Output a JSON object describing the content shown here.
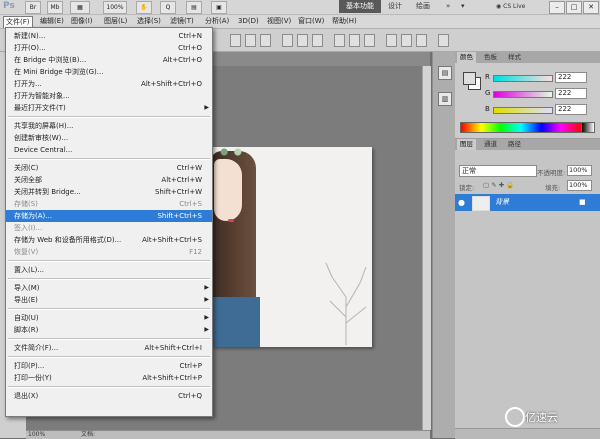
{
  "app": {
    "logo": "Ps",
    "zoom_value": "100%",
    "workspace_active": "基本功能",
    "workspace_items": [
      "设计",
      "绘画"
    ],
    "cs_live": "CS Live"
  },
  "menubar": [
    "文件(F)",
    "编辑(E)",
    "图像(I)",
    "图层(L)",
    "选择(S)",
    "滤镜(T)",
    "分析(A)",
    "3D(D)",
    "视图(V)",
    "窗口(W)",
    "帮助(H)"
  ],
  "file_menu": [
    {
      "label": "新建(N)...",
      "shortcut": "Ctrl+N"
    },
    {
      "label": "打开(O)...",
      "shortcut": "Ctrl+O"
    },
    {
      "label": "在 Bridge 中浏览(B)...",
      "shortcut": "Alt+Ctrl+O"
    },
    {
      "label": "在 Mini Bridge 中浏览(G)...",
      "shortcut": ""
    },
    {
      "label": "打开为...",
      "shortcut": "Alt+Shift+Ctrl+O"
    },
    {
      "label": "打开为智能对象...",
      "shortcut": ""
    },
    {
      "label": "最近打开文件(T)",
      "shortcut": "",
      "submenu": true
    },
    {
      "sep": true
    },
    {
      "label": "共享我的屏幕(H)...",
      "shortcut": ""
    },
    {
      "label": "创建新审核(W)...",
      "shortcut": ""
    },
    {
      "label": "Device Central...",
      "shortcut": ""
    },
    {
      "sep": true
    },
    {
      "label": "关闭(C)",
      "shortcut": "Ctrl+W"
    },
    {
      "label": "关闭全部",
      "shortcut": "Alt+Ctrl+W"
    },
    {
      "label": "关闭并转到 Bridge...",
      "shortcut": "Shift+Ctrl+W"
    },
    {
      "label": "存储(S)",
      "shortcut": "Ctrl+S",
      "disabled": true
    },
    {
      "label": "存储为(A)...",
      "shortcut": "Shift+Ctrl+S",
      "highlight": true
    },
    {
      "label": "签入(I)...",
      "shortcut": "",
      "disabled": true
    },
    {
      "label": "存储为 Web 和设备所用格式(D)...",
      "shortcut": "Alt+Shift+Ctrl+S"
    },
    {
      "label": "恢复(V)",
      "shortcut": "F12",
      "disabled": true
    },
    {
      "sep": true
    },
    {
      "label": "置入(L)...",
      "shortcut": ""
    },
    {
      "sep": true
    },
    {
      "label": "导入(M)",
      "shortcut": "",
      "submenu": true
    },
    {
      "label": "导出(E)",
      "shortcut": "",
      "submenu": true
    },
    {
      "sep": true
    },
    {
      "label": "自动(U)",
      "shortcut": "",
      "submenu": true
    },
    {
      "label": "脚本(R)",
      "shortcut": "",
      "submenu": true
    },
    {
      "sep": true
    },
    {
      "label": "文件简介(F)...",
      "shortcut": "Alt+Shift+Ctrl+I"
    },
    {
      "sep": true
    },
    {
      "label": "打印(P)...",
      "shortcut": "Ctrl+P"
    },
    {
      "label": "打印一份(Y)",
      "shortcut": "Alt+Shift+Ctrl+P"
    },
    {
      "sep": true
    },
    {
      "label": "退出(X)",
      "shortcut": "Ctrl+Q"
    }
  ],
  "color_panel": {
    "tabs": [
      "颜色",
      "色板",
      "样式"
    ],
    "channels": [
      {
        "label": "R",
        "value": "222",
        "color": "#00b7c8"
      },
      {
        "label": "G",
        "value": "222",
        "color": "#c022c8"
      },
      {
        "label": "B",
        "value": "222",
        "color": "#e6e600"
      }
    ]
  },
  "layers_panel": {
    "tabs": [
      "图层",
      "通道",
      "路径"
    ],
    "blend_mode": "正常",
    "opacity_label": "不透明度:",
    "opacity_value": "100%",
    "lock_label": "锁定:",
    "fill_label": "填充:",
    "fill_value": "100%",
    "layer_name": "背景"
  },
  "status": {
    "zoom": "100%",
    "doc": "文档:"
  },
  "watermark": "亿速云",
  "colors": {
    "highlight": "#2f7cd6",
    "menu_bg": "#f0f0f0"
  }
}
